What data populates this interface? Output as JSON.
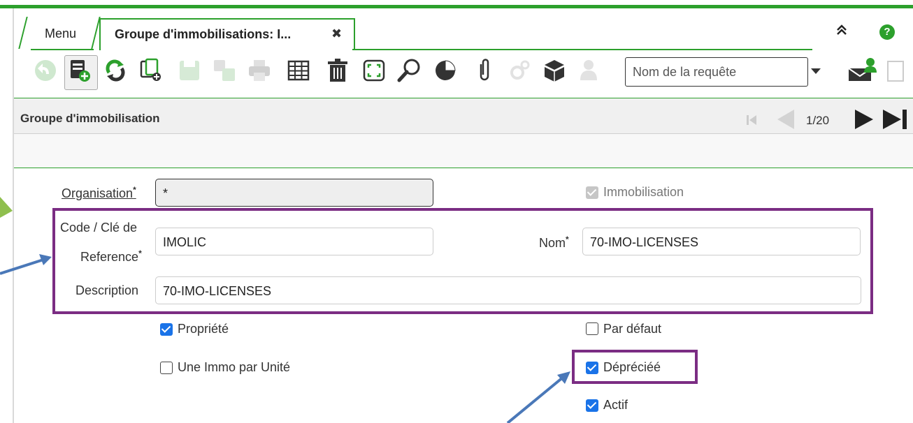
{
  "tabs": {
    "menu_label": "Menu",
    "active_label": "Groupe d'immobilisations: I...",
    "close_glyph": "✖"
  },
  "toolbar": {
    "query_placeholder": "Nom de la requête",
    "icons": [
      "undo-icon",
      "new-record-icon",
      "refresh-icon",
      "copy-record-icon",
      "save-icon",
      "save-new-icon",
      "print-icon",
      "grid-toggle-icon",
      "delete-icon",
      "fullscreen-icon",
      "find-icon",
      "chart-icon",
      "attachment-icon",
      "process-icon",
      "archive-icon",
      "user-icon",
      "email-icon"
    ]
  },
  "section": {
    "title": "Groupe d'immobilisation",
    "pager": "1/20"
  },
  "form": {
    "organisation_label": "Organisation",
    "organisation_value": "*",
    "code_label_line1": "Code / Clé de",
    "code_label_line2": "Reference",
    "code_value": "IMOLIC",
    "nom_label": "Nom",
    "nom_value": "70-IMO-LICENSES",
    "description_label": "Description",
    "description_value": "70-IMO-LICENSES",
    "required_mark": "*"
  },
  "checkboxes": {
    "immobilisation": {
      "label": "Immobilisation",
      "checked": true,
      "disabled": true
    },
    "propriete": {
      "label": "Propriété",
      "checked": true
    },
    "par_defaut": {
      "label": "Par défaut",
      "checked": false
    },
    "une_immo": {
      "label": "Une Immo par Unité",
      "checked": false
    },
    "depreciee": {
      "label": "Dépréciéé",
      "checked": true
    },
    "actif": {
      "label": "Actif",
      "checked": true
    }
  },
  "colors": {
    "accent": "#2ca02c",
    "highlight": "#7b2d83",
    "annotation_arrow": "#4a78b8",
    "checkbox": "#1a73e8"
  }
}
